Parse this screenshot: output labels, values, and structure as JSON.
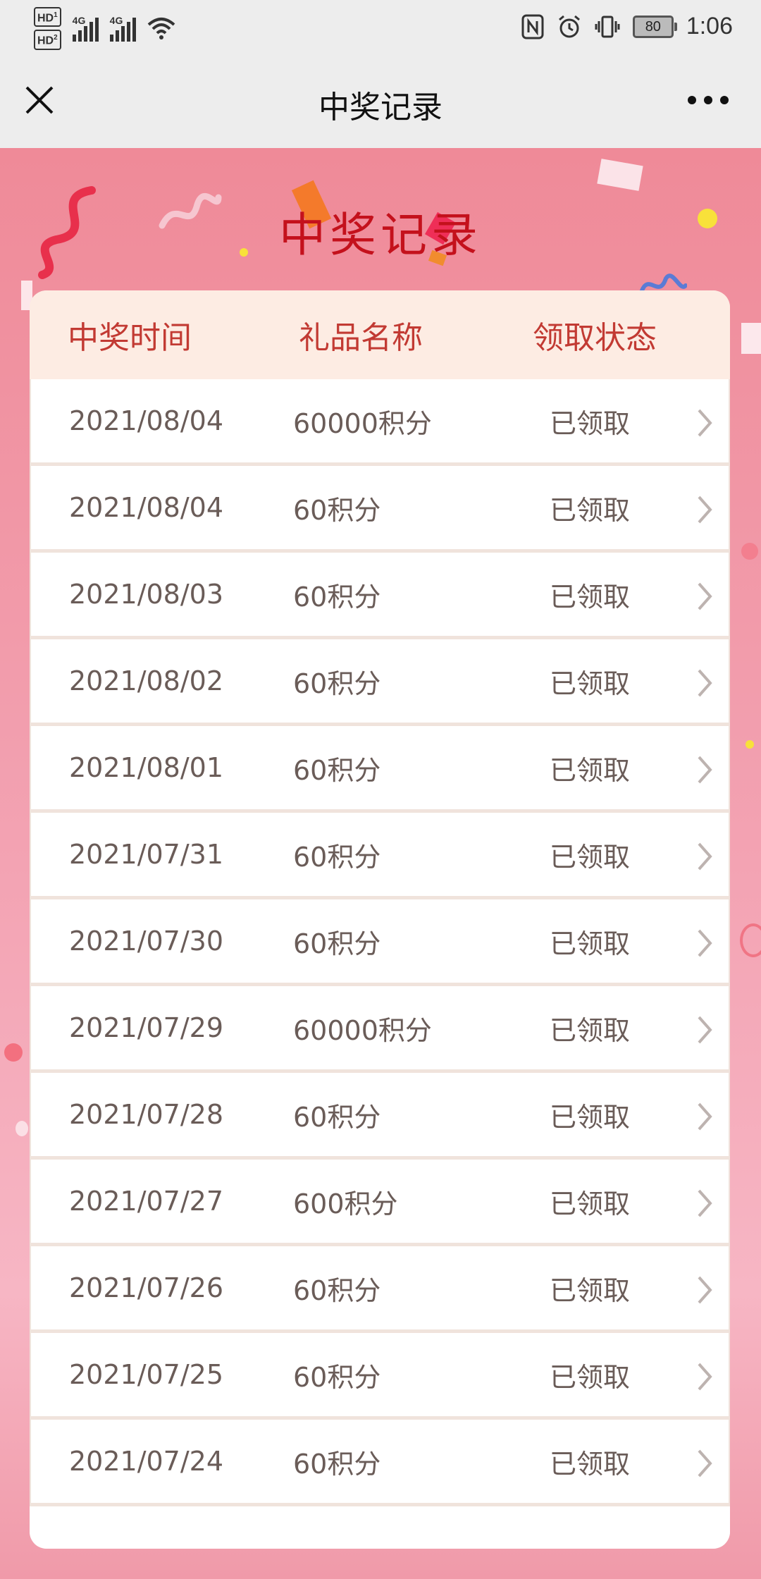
{
  "status_bar": {
    "hd1": "HD",
    "hd1_sub": "1",
    "hd2": "HD",
    "hd2_sub": "2",
    "net1": "4G",
    "net2": "4G",
    "battery": "80",
    "time": "1:06"
  },
  "nav": {
    "title": "中奖记录"
  },
  "hero": {
    "title": "中奖记录"
  },
  "table": {
    "headers": {
      "time": "中奖时间",
      "gift": "礼品名称",
      "status": "领取状态"
    },
    "rows": [
      {
        "time": "2021/08/04",
        "gift": "60000积分",
        "status": "已领取"
      },
      {
        "time": "2021/08/04",
        "gift": "60积分",
        "status": "已领取"
      },
      {
        "time": "2021/08/03",
        "gift": "60积分",
        "status": "已领取"
      },
      {
        "time": "2021/08/02",
        "gift": "60积分",
        "status": "已领取"
      },
      {
        "time": "2021/08/01",
        "gift": "60积分",
        "status": "已领取"
      },
      {
        "time": "2021/07/31",
        "gift": "60积分",
        "status": "已领取"
      },
      {
        "time": "2021/07/30",
        "gift": "60积分",
        "status": "已领取"
      },
      {
        "time": "2021/07/29",
        "gift": "60000积分",
        "status": "已领取"
      },
      {
        "time": "2021/07/28",
        "gift": "60积分",
        "status": "已领取"
      },
      {
        "time": "2021/07/27",
        "gift": "600积分",
        "status": "已领取"
      },
      {
        "time": "2021/07/26",
        "gift": "60积分",
        "status": "已领取"
      },
      {
        "time": "2021/07/25",
        "gift": "60积分",
        "status": "已领取"
      },
      {
        "time": "2021/07/24",
        "gift": "60积分",
        "status": "已领取"
      }
    ]
  },
  "colors": {
    "accent": "#c23a33",
    "hero_title": "#c4111c",
    "row_text": "#6a5c58"
  }
}
